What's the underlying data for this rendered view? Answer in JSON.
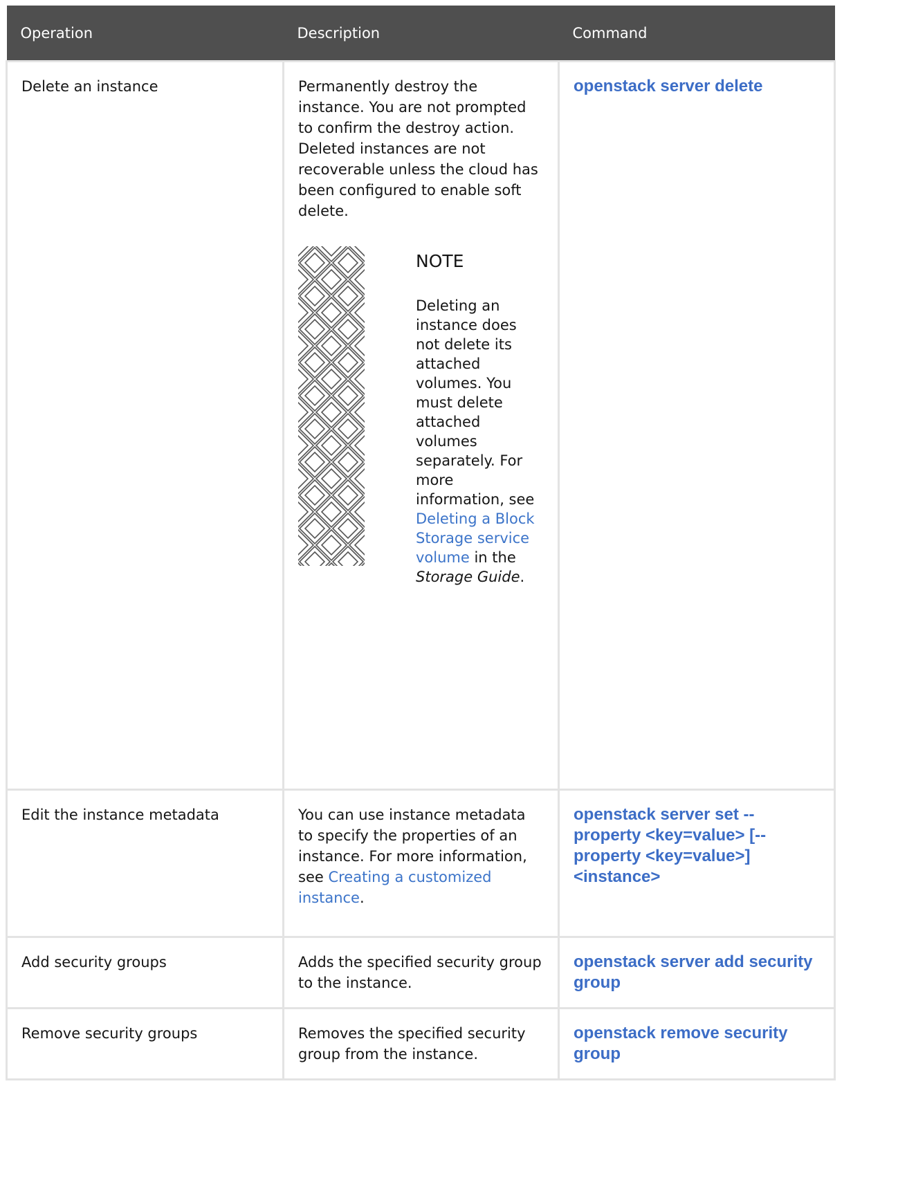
{
  "table": {
    "headers": [
      "Operation",
      "Description",
      "Command"
    ],
    "rows": [
      {
        "operation": "Delete an instance",
        "description": "Permanently destroy the instance. You are not prompted to confirm the destroy action. Deleted instances are not recoverable unless the cloud has been configured to enable soft delete.",
        "note": {
          "title": "NOTE",
          "text_before": "Deleting an instance does not delete its attached volumes. You must delete attached volumes separately. For more information, see ",
          "link": "Deleting a Block Storage service volume",
          "text_mid": " in the ",
          "italic": "Storage Guide",
          "text_after": "."
        },
        "command": "openstack server delete"
      },
      {
        "operation": "Edit the instance metadata",
        "description_before": "You can use instance metadata to specify the properties of an instance. For more information, see ",
        "description_link": "Creating a customized instance",
        "description_after": ".",
        "command": "openstack server set --property <key=value> [--property <key=value>] <instance>"
      },
      {
        "operation": "Add security groups",
        "description": "Adds the specified security group to the instance.",
        "command": "openstack server add security group"
      },
      {
        "operation": "Remove security groups",
        "description": "Removes the specified security group from the instance.",
        "command": "openstack remove security group"
      }
    ]
  }
}
